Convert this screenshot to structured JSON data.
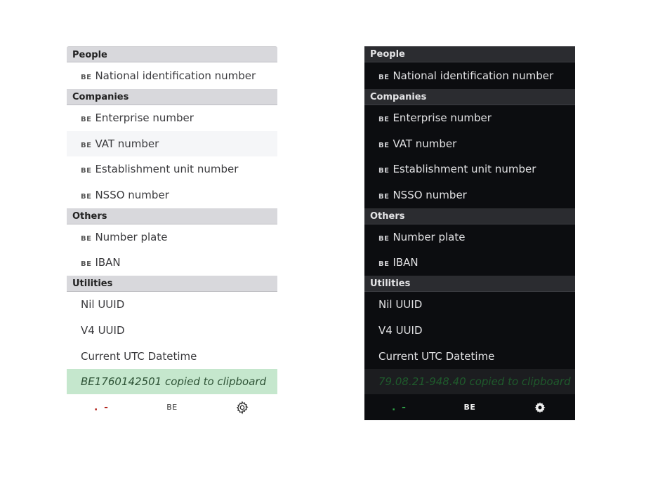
{
  "light": {
    "sections": [
      {
        "title": "People",
        "items": [
          {
            "flag": "BE",
            "label": "National identification number"
          }
        ]
      },
      {
        "title": "Companies",
        "items": [
          {
            "flag": "BE",
            "label": "Enterprise number"
          },
          {
            "flag": "BE",
            "label": "VAT number"
          },
          {
            "flag": "BE",
            "label": "Establishment unit number"
          },
          {
            "flag": "BE",
            "label": "NSSO number"
          }
        ]
      },
      {
        "title": "Others",
        "items": [
          {
            "flag": "BE",
            "label": "Number plate"
          },
          {
            "flag": "BE",
            "label": "IBAN"
          }
        ]
      },
      {
        "title": "Utilities",
        "items": [
          {
            "flag": "",
            "label": "Nil UUID"
          },
          {
            "flag": "",
            "label": "V4 UUID"
          },
          {
            "flag": "",
            "label": "Current UTC Datetime"
          }
        ]
      }
    ],
    "toast": "BE1760142501 copied to clipboard",
    "footer": {
      "status": ". -",
      "country": "BE"
    }
  },
  "dark": {
    "sections": [
      {
        "title": "People",
        "items": [
          {
            "flag": "BE",
            "label": "National identification number"
          }
        ]
      },
      {
        "title": "Companies",
        "items": [
          {
            "flag": "BE",
            "label": "Enterprise number"
          },
          {
            "flag": "BE",
            "label": "VAT number"
          },
          {
            "flag": "BE",
            "label": "Establishment unit number"
          },
          {
            "flag": "BE",
            "label": "NSSO number"
          }
        ]
      },
      {
        "title": "Others",
        "items": [
          {
            "flag": "BE",
            "label": "Number plate"
          },
          {
            "flag": "BE",
            "label": "IBAN"
          }
        ]
      },
      {
        "title": "Utilities",
        "items": [
          {
            "flag": "",
            "label": "Nil UUID"
          },
          {
            "flag": "",
            "label": "V4 UUID"
          },
          {
            "flag": "",
            "label": "Current UTC Datetime"
          }
        ]
      }
    ],
    "toast": "79.08.21-948.40 copied to clipboard",
    "footer": {
      "status": ". -",
      "country": "BE"
    }
  },
  "colors": {
    "light_header_bg": "#d8d8dc",
    "dark_panel_bg": "#0c0d10",
    "light_toast_bg": "#c5e7cd",
    "light_status": "#b3261e",
    "dark_status": "#2d9a44"
  },
  "icons": {
    "settings": "gear-icon"
  }
}
